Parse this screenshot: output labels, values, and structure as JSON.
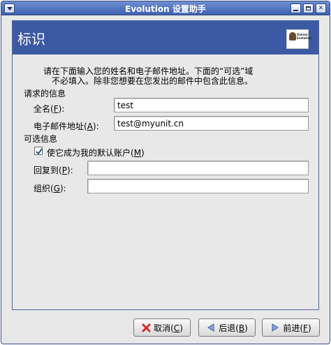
{
  "window": {
    "title": "Evolution 设置助手"
  },
  "page": {
    "title": "标识",
    "intro_line1": "请在下面输入您的姓名和电子邮件地址。下面的“可选”域",
    "intro_line2": "不必填入。除非您想要在您发出的邮件中包含此信息。"
  },
  "required": {
    "heading": "请求的信息",
    "fullname_label_pre": "全名(",
    "fullname_mnemonic": "F",
    "fullname_label_post": "):",
    "fullname_value": "test",
    "email_label_pre": "电子邮件地址(",
    "email_mnemonic": "A",
    "email_label_post": "):",
    "email_value": "test@myunit.cn"
  },
  "optional": {
    "heading": "可选信息",
    "default_label_pre": "使它成为我的默认账户(",
    "default_mnemonic": "M",
    "default_label_post": ")",
    "default_checked": true,
    "reply_label_pre": "回复到(",
    "reply_mnemonic": "P",
    "reply_label_post": "):",
    "reply_value": "",
    "org_label_pre": "组织(",
    "org_mnemonic": "G",
    "org_label_post": "):",
    "org_value": ""
  },
  "buttons": {
    "cancel_pre": "取消(",
    "cancel_mnemonic": "C",
    "cancel_post": ")",
    "back_pre": "后退(",
    "back_mnemonic": "B",
    "back_post": ")",
    "forward_pre": "前进(",
    "forward_mnemonic": "F",
    "forward_post": ")"
  },
  "icons": {
    "window_menu": "chevron-down-icon",
    "cancel": "close-icon",
    "back": "arrow-left-icon",
    "forward": "arrow-right-icon",
    "check": "checkmark-icon"
  },
  "colors": {
    "header_bg": "#3b5aa3",
    "titlebar": "#3f62b2",
    "cancel_icon": "#d22b2b",
    "nav_icon": "#5a77c0"
  }
}
